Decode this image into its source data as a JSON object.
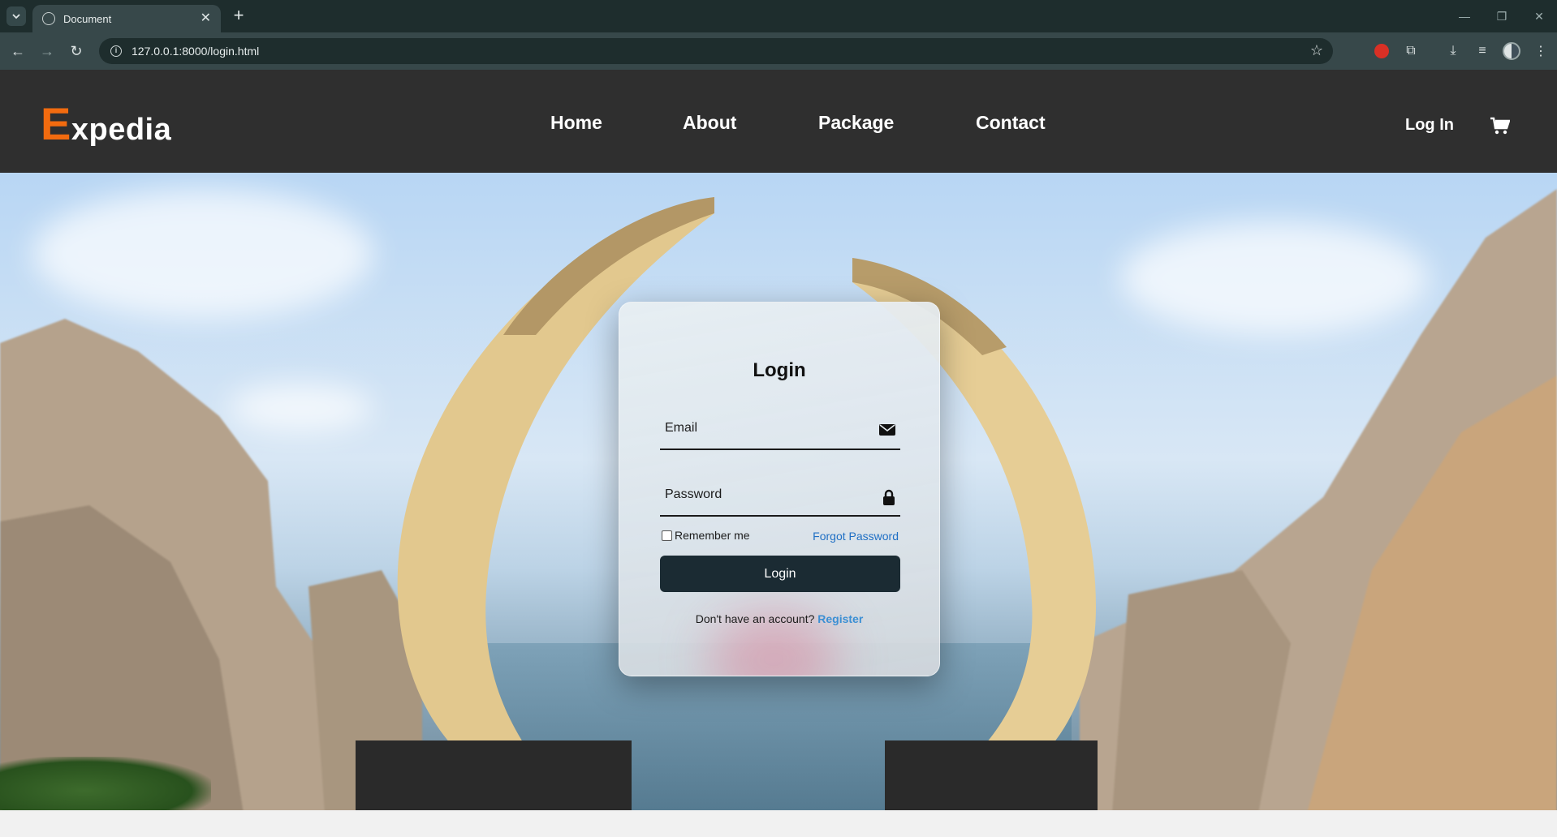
{
  "browser": {
    "tab_title": "Document",
    "url": "127.0.0.1:8000/login.html",
    "new_tab_symbol": "+",
    "close_symbol": "✕"
  },
  "site": {
    "logo_initial": "E",
    "logo_rest": "xpedia",
    "nav": [
      {
        "label": "Home"
      },
      {
        "label": "About"
      },
      {
        "label": "Package"
      },
      {
        "label": "Contact"
      }
    ],
    "login_link": "Log In",
    "accent": "#f26b0f"
  },
  "login_card": {
    "title": "Login",
    "email_placeholder": "Email",
    "password_placeholder": "Password",
    "remember_label": "Remember me",
    "forgot_label": "Forgot Password",
    "button_label": "Login",
    "register_prompt": "Don't have an account?",
    "register_label": "Register"
  },
  "icons": {
    "email": "envelope-icon",
    "password": "lock-icon",
    "cart": "shopping-cart-icon"
  }
}
